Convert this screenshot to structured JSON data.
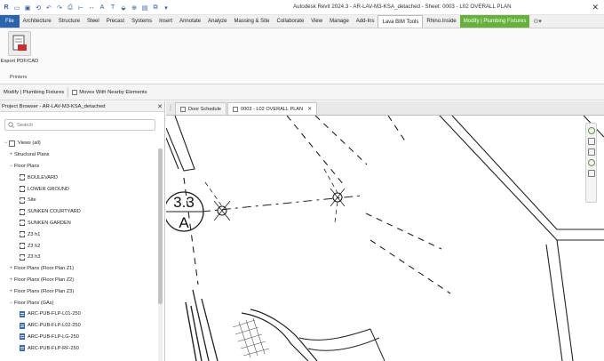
{
  "titlebar": {
    "title": "Autodesk Revit 2024.3 - AR-LAV-M3-KSA_detached - Sheet: 0003 - L02 OVERALL PLAN",
    "close_glyph": "✕"
  },
  "ribbon_tabs": [
    {
      "label": "File",
      "kind": "file"
    },
    {
      "label": "Architecture",
      "kind": "normal"
    },
    {
      "label": "Structure",
      "kind": "normal"
    },
    {
      "label": "Steel",
      "kind": "normal"
    },
    {
      "label": "Precast",
      "kind": "normal"
    },
    {
      "label": "Systems",
      "kind": "normal"
    },
    {
      "label": "Insert",
      "kind": "normal"
    },
    {
      "label": "Annotate",
      "kind": "normal"
    },
    {
      "label": "Analyze",
      "kind": "normal"
    },
    {
      "label": "Massing & Site",
      "kind": "normal"
    },
    {
      "label": "Collaborate",
      "kind": "normal"
    },
    {
      "label": "View",
      "kind": "normal"
    },
    {
      "label": "Manage",
      "kind": "normal"
    },
    {
      "label": "Add-Ins",
      "kind": "normal"
    },
    {
      "label": "Lava BIM Tools",
      "kind": "active"
    },
    {
      "label": "Rhino.Inside",
      "kind": "normal"
    },
    {
      "label": "Modify | Plumbing Fixtures",
      "kind": "ctx"
    }
  ],
  "ribbon": {
    "export_label": "Export PDF/CAD",
    "panel_label": "Printers"
  },
  "options_bar": {
    "context_label": "Modify | Plumbing Fixtures",
    "moves_with_label": "Moves With Nearby Elements"
  },
  "browser": {
    "title": "Project Browser - AR-LAV-M3-KSA_detached",
    "close_glyph": "✕",
    "search_placeholder": "Search",
    "nodes": [
      {
        "label": "Views (all)",
        "indent": 0,
        "exp": "−",
        "icon": "tree"
      },
      {
        "label": "Structural Plans",
        "indent": 1,
        "exp": "+",
        "icon": "none"
      },
      {
        "label": "Floor Plans",
        "indent": 1,
        "exp": "−",
        "icon": "none"
      },
      {
        "label": "BOULEVARD",
        "indent": 2,
        "exp": "",
        "icon": "view"
      },
      {
        "label": "LOWER GROUND",
        "indent": 2,
        "exp": "",
        "icon": "view"
      },
      {
        "label": "Site",
        "indent": 2,
        "exp": "",
        "icon": "view"
      },
      {
        "label": "SUNKEN COURTYARD",
        "indent": 2,
        "exp": "",
        "icon": "view"
      },
      {
        "label": "SUNKEN GARDEN",
        "indent": 2,
        "exp": "",
        "icon": "view"
      },
      {
        "label": "Z3 h1",
        "indent": 2,
        "exp": "",
        "icon": "view"
      },
      {
        "label": "Z3 h2",
        "indent": 2,
        "exp": "",
        "icon": "view"
      },
      {
        "label": "Z3 h3",
        "indent": 2,
        "exp": "",
        "icon": "view"
      },
      {
        "label": "Floor Plans (Floor Plan Z1)",
        "indent": 1,
        "exp": "+",
        "icon": "none"
      },
      {
        "label": "Floor Plans (Floor Plan Z2)",
        "indent": 1,
        "exp": "+",
        "icon": "none"
      },
      {
        "label": "Floor Plans (Floor Plan Z3)",
        "indent": 1,
        "exp": "+",
        "icon": "none"
      },
      {
        "label": "Floor Plans (GAs)",
        "indent": 1,
        "exp": "−",
        "icon": "none"
      },
      {
        "label": "ARC-PUB-FLP-L01-250",
        "indent": 2,
        "exp": "",
        "icon": "sheet"
      },
      {
        "label": "ARC-PUB-FLP-L02-250",
        "indent": 2,
        "exp": "",
        "icon": "sheet"
      },
      {
        "label": "ARC-PUB-FLP-LG-250",
        "indent": 2,
        "exp": "",
        "icon": "sheet"
      },
      {
        "label": "ARC-PUB-FLP-RF-250",
        "indent": 2,
        "exp": "",
        "icon": "sheet"
      }
    ]
  },
  "doc_tabs": [
    {
      "label": "Door Schedule",
      "active": false
    },
    {
      "label": "0003 - L02 OVERALL PLAN",
      "active": true
    }
  ],
  "drawing": {
    "grid_bubble_number": "3.3",
    "grid_bubble_letter": "A"
  },
  "colors": {
    "file_tab": "#2a64b0",
    "contextual_tab": "#66b13a"
  }
}
